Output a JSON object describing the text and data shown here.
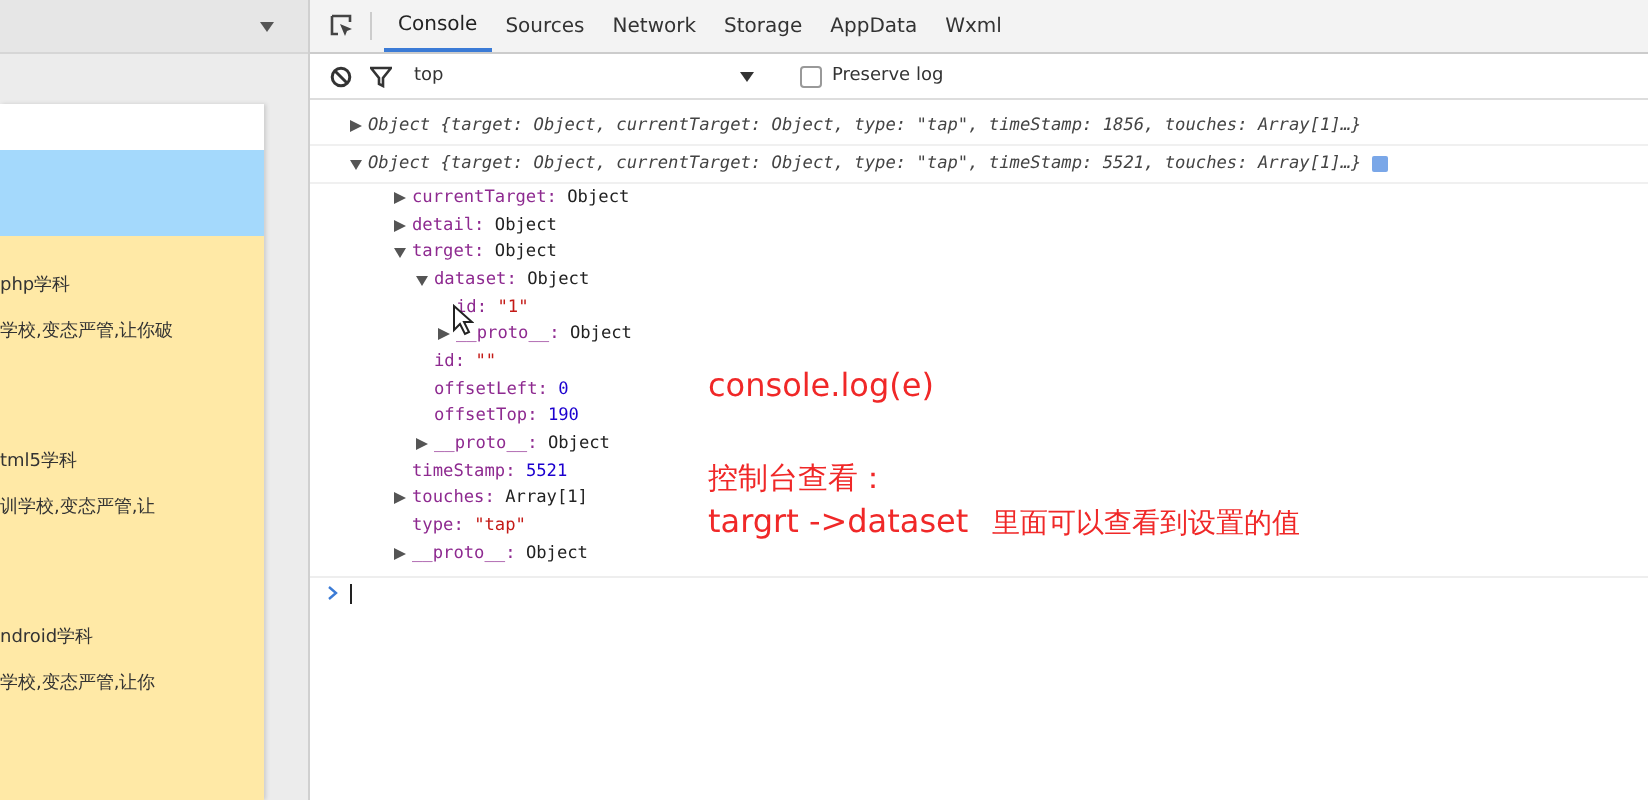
{
  "simulator": {
    "list_items": [
      {
        "title": "php学科",
        "desc": "学校,变态严管,让你破"
      },
      {
        "title": "tml5学科",
        "desc": "训学校,变态严管,让"
      },
      {
        "title": "ndroid学科",
        "desc": "学校,变态严管,让你"
      }
    ]
  },
  "devtools": {
    "tabs": [
      {
        "label": "Console",
        "selected": true
      },
      {
        "label": "Sources",
        "selected": false
      },
      {
        "label": "Network",
        "selected": false
      },
      {
        "label": "Storage",
        "selected": false
      },
      {
        "label": "AppData",
        "selected": false
      },
      {
        "label": "Wxml",
        "selected": false
      }
    ],
    "context": "top",
    "preserve_log": {
      "label": "Preserve log",
      "checked": false
    },
    "entries": [
      {
        "kind": "node",
        "expanded": false,
        "summary": "Object {target: Object, currentTarget: Object, type: \"tap\", timeStamp: 1856, touches: Array[1]…}",
        "info": false
      },
      {
        "kind": "node",
        "expanded": true,
        "summary": "Object {target: Object, currentTarget: Object, type: \"tap\", timeStamp: 5521, touches: Array[1]…}",
        "info": true,
        "children": [
          {
            "kind": "node",
            "key": "currentTarget:",
            "value": "Object",
            "expanded": false
          },
          {
            "kind": "node",
            "key": "detail:",
            "value": "Object",
            "expanded": false
          },
          {
            "kind": "node",
            "key": "target:",
            "value": "Object",
            "expanded": true,
            "children": [
              {
                "kind": "node",
                "key": "dataset:",
                "value": "Object",
                "expanded": true,
                "children": [
                  {
                    "kind": "leaf",
                    "key": "id:",
                    "value": "\"1\"",
                    "color": "#c41a16"
                  },
                  {
                    "kind": "node",
                    "key": "__proto__:",
                    "value": "Object",
                    "expanded": false
                  }
                ]
              },
              {
                "kind": "leaf",
                "key": "id:",
                "value": "\"\"",
                "color": "#c41a16"
              },
              {
                "kind": "leaf",
                "key": "offsetLeft:",
                "value": "0",
                "color": "#1c00cf"
              },
              {
                "kind": "leaf",
                "key": "offsetTop:",
                "value": "190",
                "color": "#1c00cf"
              },
              {
                "kind": "node",
                "key": "__proto__:",
                "value": "Object",
                "expanded": false
              }
            ]
          },
          {
            "kind": "leaf",
            "key": "timeStamp:",
            "value": "5521",
            "color": "#1c00cf"
          },
          {
            "kind": "node",
            "key": "touches:",
            "value": "Array[1]",
            "expanded": false
          },
          {
            "kind": "leaf",
            "key": "type:",
            "value": "\"tap\"",
            "color": "#c41a16"
          },
          {
            "kind": "node",
            "key": "__proto__:",
            "value": "Object",
            "expanded": false
          }
        ]
      }
    ]
  },
  "annotations": {
    "code": "console.log(e)",
    "lines": [
      "控制台查看："
    ],
    "path": "targrt ->dataset",
    "note": "里面可以查看到设置的值"
  }
}
